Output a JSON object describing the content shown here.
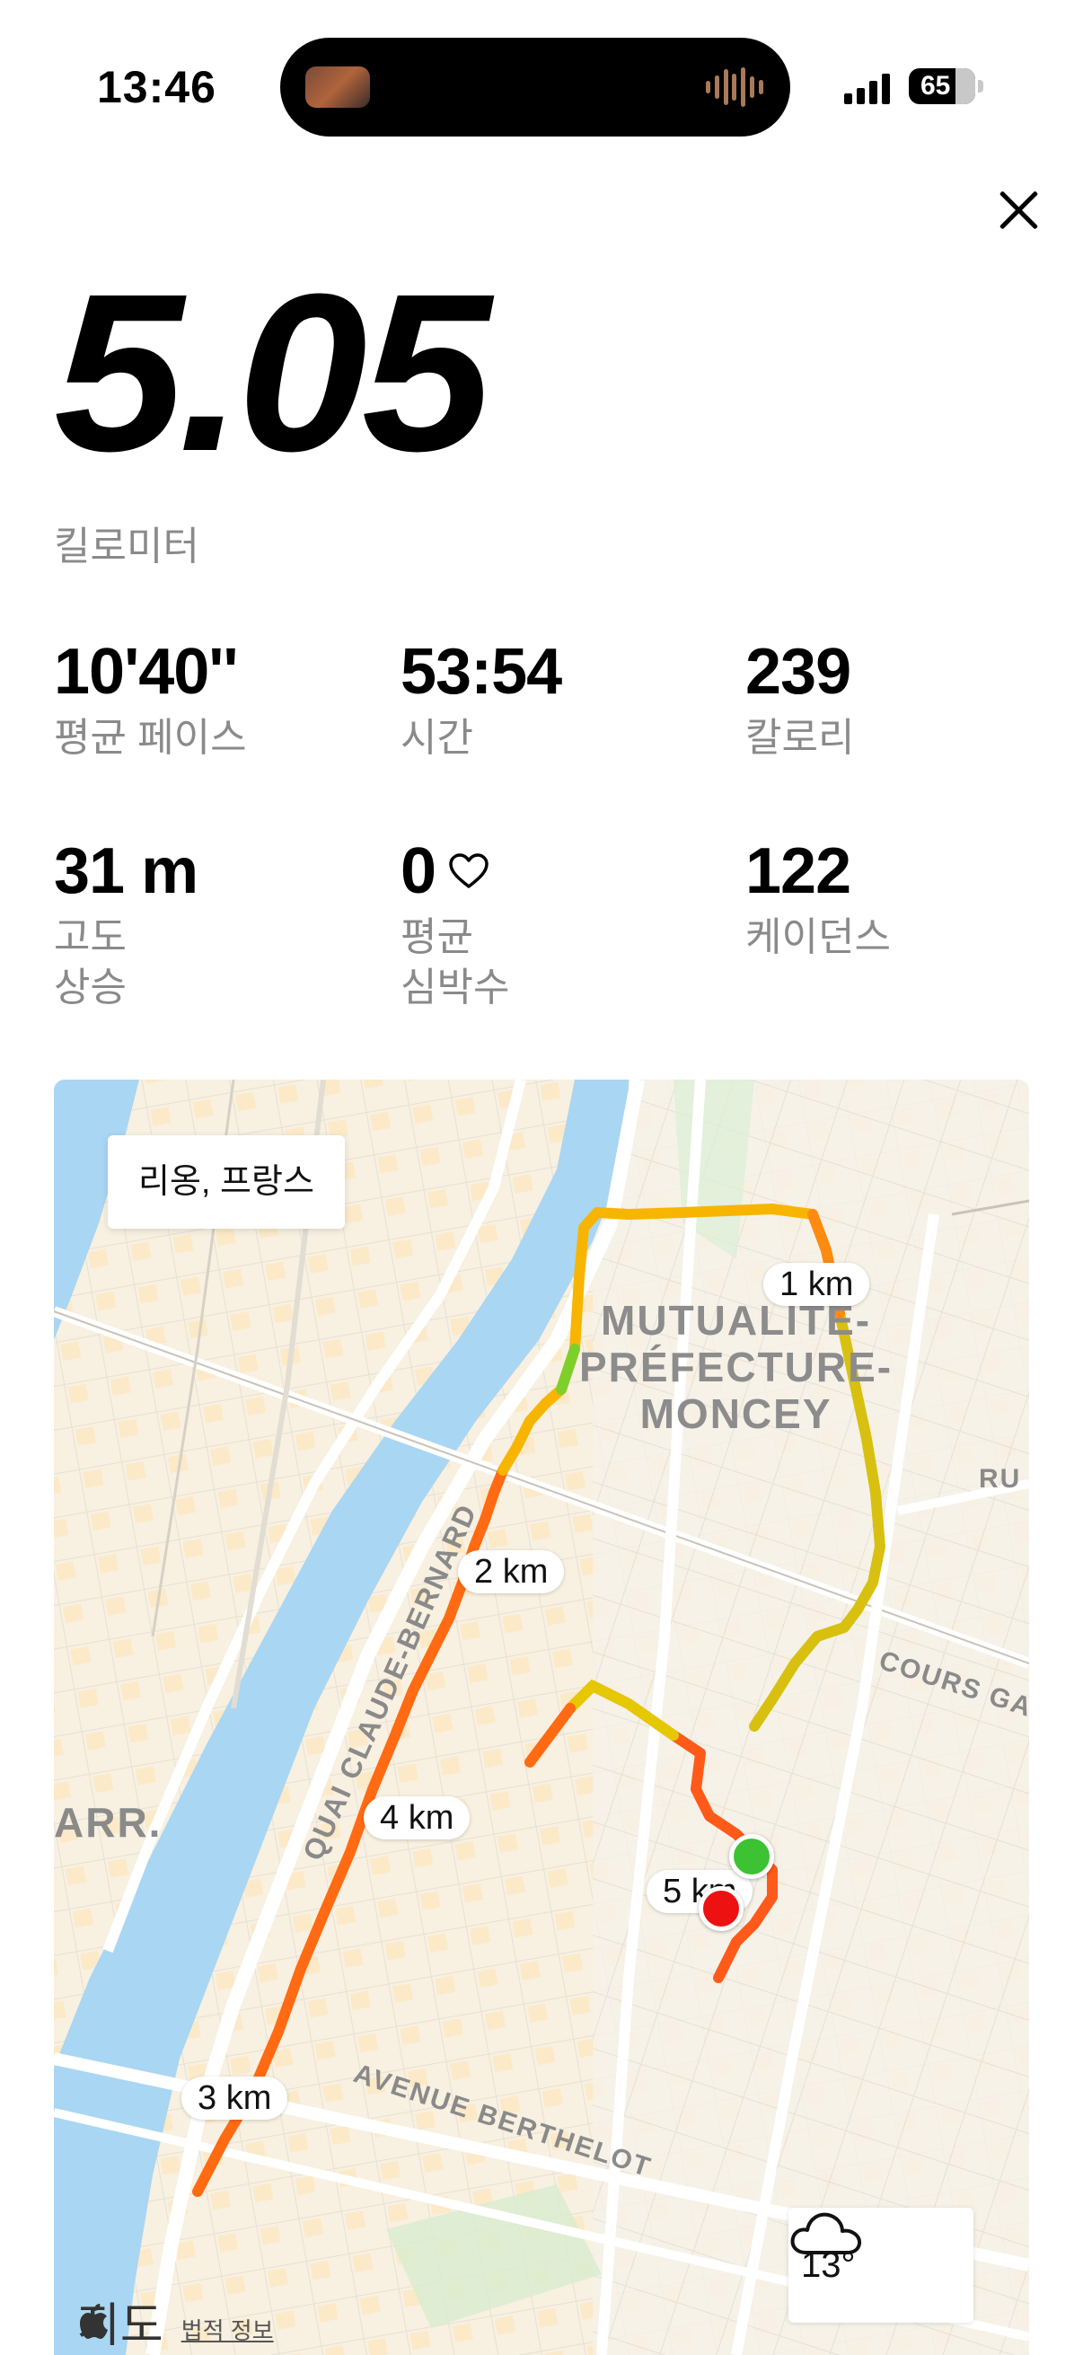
{
  "status": {
    "time": "13:46",
    "battery": "65"
  },
  "hero": {
    "distance": "5.05",
    "unit": "킬로미터"
  },
  "stats": [
    {
      "value": "10'40''",
      "label": "평균 페이스"
    },
    {
      "value": "53:54",
      "label": "시간"
    },
    {
      "value": "239",
      "label": "칼로리"
    },
    {
      "value": "31 m",
      "label": "고도\n상승"
    },
    {
      "value": "0",
      "label": "평균\n심박수"
    },
    {
      "value": "122",
      "label": "케이던스"
    }
  ],
  "map": {
    "location": "리옹, 프랑스",
    "km_markers": [
      "1 km",
      "2 km",
      "4 km",
      "3 km",
      "5 km"
    ],
    "district": [
      "MUTUALITÉ-",
      "PRÉFECTURE-",
      "MONCEY"
    ],
    "streets": [
      "QUAI CLAUDE-BERNARD",
      "AVENUE BERTHELOT",
      "COURS GA",
      "RU",
      "ARR."
    ],
    "weather": {
      "temp": "13°",
      "icon": "cloud-icon"
    },
    "brand": "지도",
    "legal": "법적 정보",
    "colors": {
      "water": "#a9d6f2",
      "route_fast": "#ff5a1a",
      "route_mid": "#f7b500",
      "route_slow": "#c8e01a",
      "start": "#3cc232",
      "end": "#ee1111"
    }
  }
}
